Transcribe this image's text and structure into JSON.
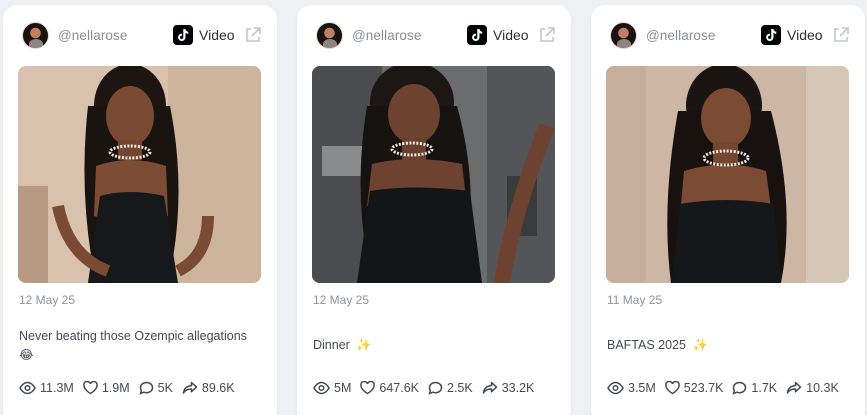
{
  "accent": "#8a8d99",
  "posts": [
    {
      "handle": "@nellarose",
      "platform_icon": "tiktok-icon",
      "type_label": "Video",
      "date": "12 May 25",
      "caption": "Never beating those Ozempic allegations",
      "caption_emoji": "😂",
      "stats": {
        "views": "11.3M",
        "likes": "1.9M",
        "comments": "5K",
        "shares": "89.6K"
      }
    },
    {
      "handle": "@nellarose",
      "platform_icon": "tiktok-icon",
      "type_label": "Video",
      "date": "12 May 25",
      "caption": "Dinner",
      "caption_emoji": "✨",
      "stats": {
        "views": "5M",
        "likes": "647.6K",
        "comments": "2.5K",
        "shares": "33.2K"
      }
    },
    {
      "handle": "@nellarose",
      "platform_icon": "tiktok-icon",
      "type_label": "Video",
      "date": "11 May 25",
      "caption": "BAFTAS 2025",
      "caption_emoji": "✨",
      "stats": {
        "views": "3.5M",
        "likes": "523.7K",
        "comments": "1.7K",
        "shares": "10.3K"
      }
    }
  ]
}
